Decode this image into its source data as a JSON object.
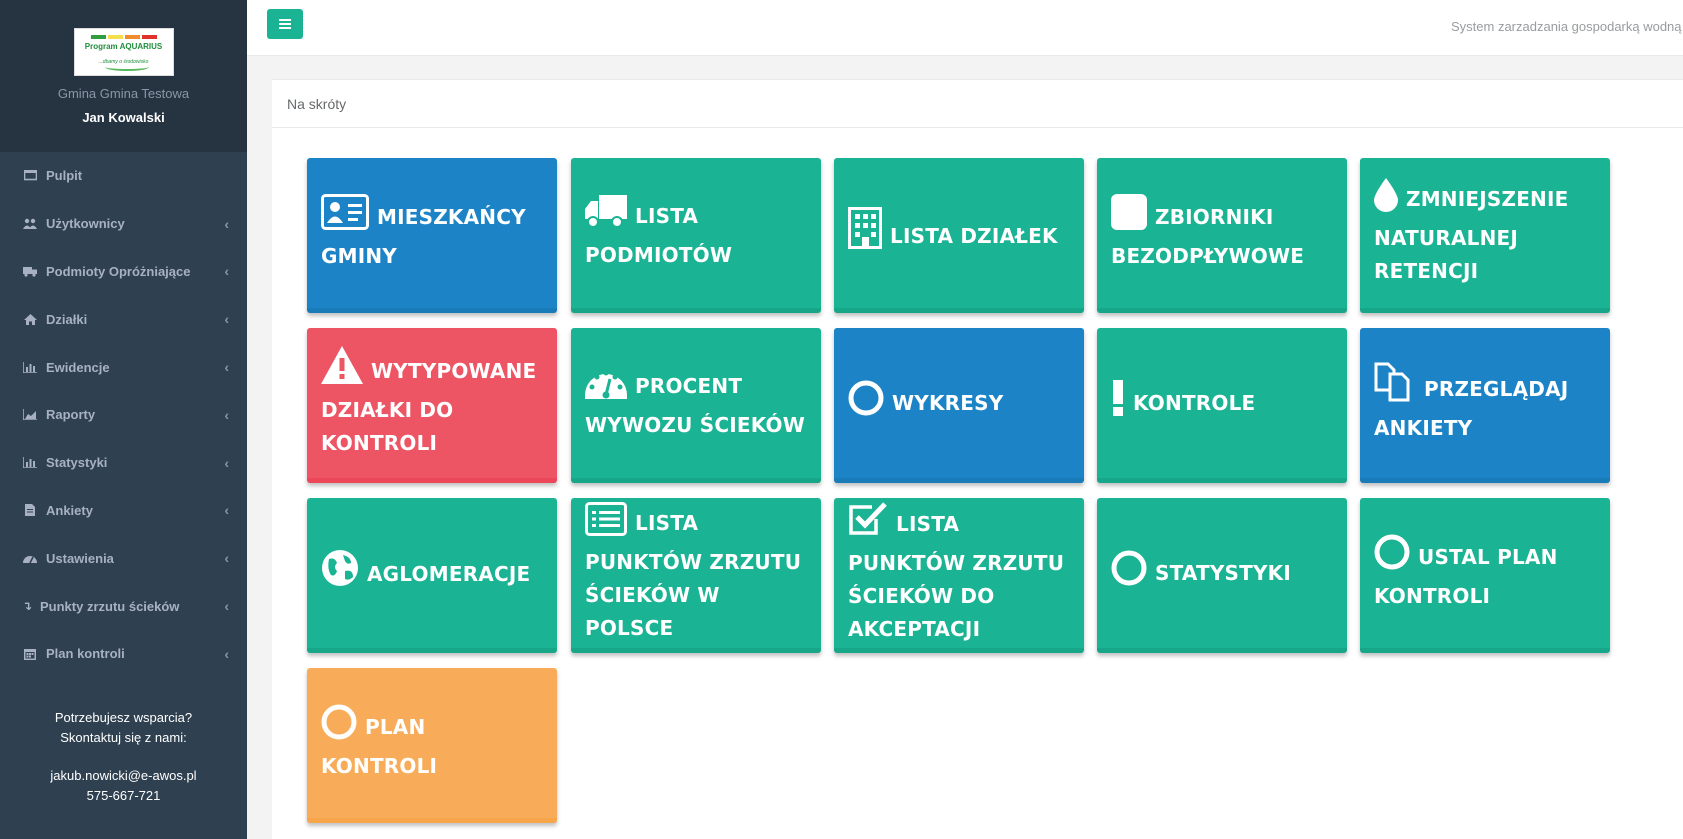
{
  "sidebar": {
    "logo": {
      "title": "Program AQUARIUS",
      "tagline": "...dbamy o środowisko"
    },
    "gmina": "Gmina Gmina Testowa",
    "user": "Jan Kowalski",
    "items": [
      {
        "label": "Pulpit",
        "icon": "desktop-icon",
        "expandable": false
      },
      {
        "label": "Użytkownicy",
        "icon": "users-icon",
        "expandable": true
      },
      {
        "label": "Podmioty Opróżniające",
        "icon": "truck-icon",
        "expandable": true
      },
      {
        "label": "Działki",
        "icon": "home-icon",
        "expandable": true
      },
      {
        "label": "Ewidencje",
        "icon": "bar-chart-icon",
        "expandable": true
      },
      {
        "label": "Raporty",
        "icon": "area-chart-icon",
        "expandable": true
      },
      {
        "label": "Statystyki",
        "icon": "bar-chart-icon",
        "expandable": true
      },
      {
        "label": "Ankiety",
        "icon": "file-icon",
        "expandable": true
      },
      {
        "label": "Ustawienia",
        "icon": "gauge-icon",
        "expandable": true
      },
      {
        "label": "Punkty zrzutu ścieków",
        "icon": "level-down-icon",
        "expandable": true
      },
      {
        "label": "Plan kontroli",
        "icon": "calendar-icon",
        "expandable": true
      }
    ],
    "support": {
      "line1": "Potrzebujesz wsparcia?",
      "line2": "Skontaktuj się z nami:",
      "email": "jakub.nowicki@e-awos.pl",
      "phone": "575-667-721"
    }
  },
  "topbar": {
    "system_name": "System zarzadzania gospodarką wodną"
  },
  "panel": {
    "title": "Na skróty",
    "tiles": [
      {
        "label": "Mieszkańcy gminy",
        "icon": "id-card-icon",
        "color": "#1c84c6"
      },
      {
        "label": "Lista podmiotów",
        "icon": "truck-icon",
        "color": "#1ab394"
      },
      {
        "label": "Lista działek",
        "icon": "building-icon",
        "color": "#1ab394"
      },
      {
        "label": "Zbiorniki bezodpływowe",
        "icon": "square-icon",
        "color": "#1ab394"
      },
      {
        "label": "Zmniejszenie naturalnej retencji",
        "icon": "tint-icon",
        "color": "#1ab394"
      },
      {
        "label": "Wytypowane działki do kontroli",
        "icon": "warning-icon",
        "color": "#ed5565"
      },
      {
        "label": "Procent wywozu ścieków",
        "icon": "dashboard-icon",
        "color": "#1ab394"
      },
      {
        "label": "Wykresy",
        "icon": "circle-icon",
        "color": "#1c84c6"
      },
      {
        "label": "Kontrole",
        "icon": "exclamation-icon",
        "color": "#1ab394"
      },
      {
        "label": "Przeglądaj ankiety",
        "icon": "files-icon",
        "color": "#1c84c6"
      },
      {
        "label": "Aglomeracje",
        "icon": "globe-icon",
        "color": "#1ab394"
      },
      {
        "label": "Lista punktów zrzutu ścieków w Polsce",
        "icon": "list-alt-icon",
        "color": "#1ab394"
      },
      {
        "label": "Lista punktów zrzutu ścieków do akceptacji",
        "icon": "check-square-icon",
        "color": "#1ab394"
      },
      {
        "label": "Statystyki",
        "icon": "circle-icon",
        "color": "#1ab394"
      },
      {
        "label": "Ustal plan kontroli",
        "icon": "circle-icon",
        "color": "#1ab394"
      },
      {
        "label": "Plan kontroli",
        "icon": "circle-icon",
        "color": "#f8ac59"
      }
    ]
  }
}
